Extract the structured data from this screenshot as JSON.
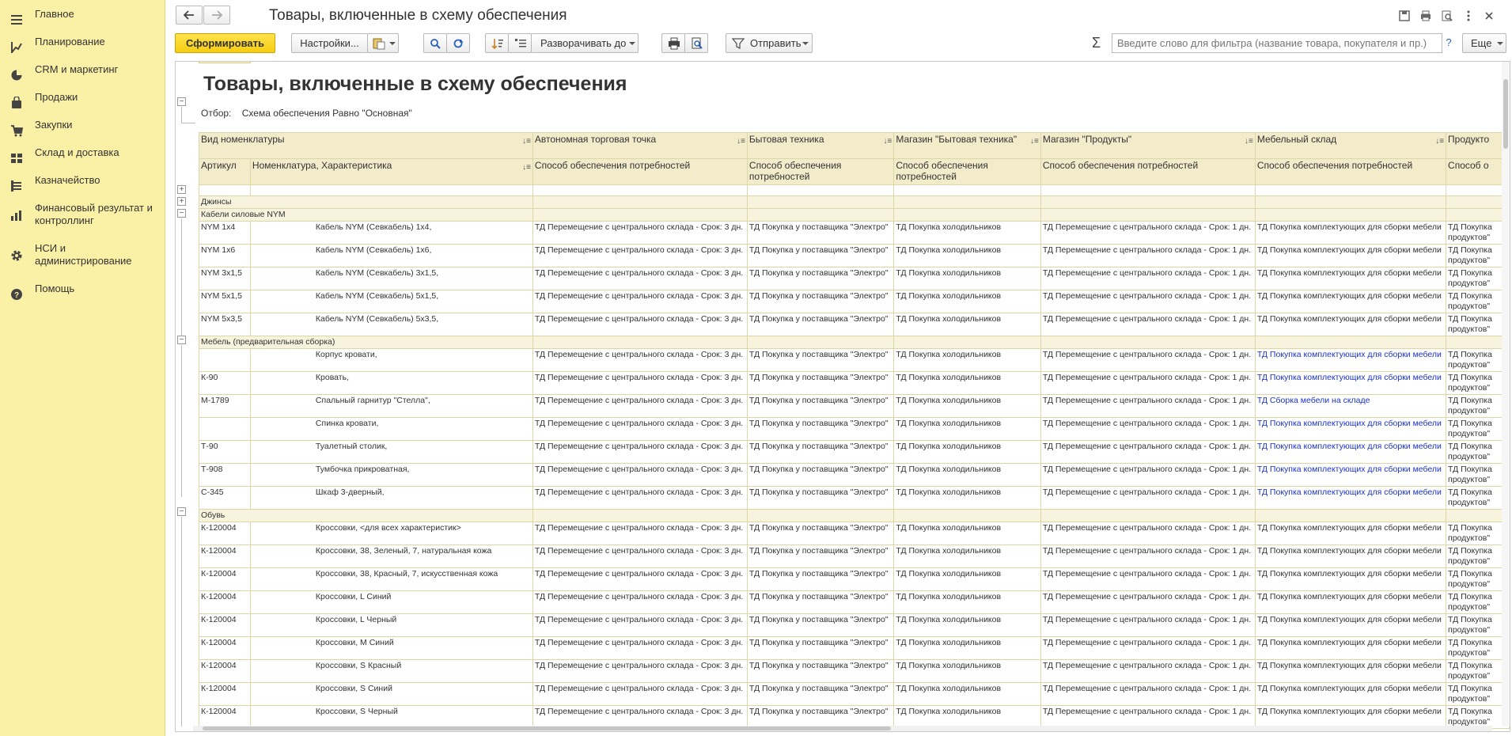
{
  "sidebar": {
    "items": [
      {
        "label": "Главное",
        "icon": "menu-icon"
      },
      {
        "label": "Планирование",
        "icon": "planning-icon"
      },
      {
        "label": "CRM и маркетинг",
        "icon": "pie-icon"
      },
      {
        "label": "Продажи",
        "icon": "bag-icon"
      },
      {
        "label": "Закупки",
        "icon": "cart-icon"
      },
      {
        "label": "Склад и доставка",
        "icon": "warehouse-icon"
      },
      {
        "label": "Казначейство",
        "icon": "treasury-icon"
      },
      {
        "label": "Финансовый результат и контроллинг",
        "icon": "bars-icon"
      },
      {
        "label": "НСИ и администрирование",
        "icon": "gear-icon"
      },
      {
        "label": "Помощь",
        "icon": "help-icon"
      }
    ]
  },
  "header": {
    "title": "Товары, включенные в схему обеспечения"
  },
  "toolbar": {
    "generate": "Сформировать",
    "settings": "Настройки...",
    "expand": "Разворачивать до",
    "send": "Отправить",
    "more": "Еще",
    "sigma": "Σ",
    "help": "?",
    "filter_placeholder": "Введите слово для фильтра (название товара, покупателя и пр.)"
  },
  "report": {
    "title": "Товары, включенные в схему обеспечения",
    "filter_label": "Отбор:",
    "filter_value": "Схема обеспечения Равно \"Основная\"",
    "headers1": [
      "Вид номенклатуры",
      "Автономная торговая точка",
      "Бытовая техника",
      "Магазин \"Бытовая техника\"",
      "Магазин \"Продукты\"",
      "Мебельный склад",
      "Продукто"
    ],
    "headers2": [
      "Артикул",
      "Номенклатура, Характеристика",
      "Способ обеспечения потребностей",
      "Способ обеспечения потребностей",
      "Способ обеспечения потребностей",
      "Способ обеспечения потребностей",
      "Способ обеспечения потребностей",
      "Способ о"
    ],
    "groups": {
      "jeans": "Джинсы",
      "cables": "Кабели силовые NYM",
      "furniture": "Мебель (предварительная сборка)",
      "shoes": "Обувь"
    },
    "val": {
      "c1": "ТД Перемещение с центрального склада - Срок: 3 дн.",
      "c2": "ТД Покупка у поставщика \"Электро\"",
      "c3": "ТД Покупка холодильников",
      "c4": "ТД Перемещение с центрального склада - Срок: 1 дн.",
      "c5": "ТД Покупка комплектующих для сборки мебели",
      "c5b": "ТД Сборка мебели на складе",
      "c6": "ТД Покупка продуктов\""
    },
    "rows": [
      {
        "art": "NYM 1x4",
        "name": "Кабель NYM (Севкабель) 1x4,"
      },
      {
        "art": "NYM 1x6",
        "name": "Кабель NYM (Севкабель) 1x6,"
      },
      {
        "art": "NYM 3x1,5",
        "name": "Кабель NYM (Севкабель) 3x1,5,"
      },
      {
        "art": "NYM 5x1,5",
        "name": "Кабель NYM (Севкабель) 5x1,5,"
      },
      {
        "art": "NYM 5x3,5",
        "name": "Кабель NYM (Севкабель) 5x3,5,"
      },
      {
        "art": "",
        "name": "Корпус кровати,"
      },
      {
        "art": "К-90",
        "name": "Кровать,"
      },
      {
        "art": "М-1789",
        "name": "Спальный гарнитур \"Стелла\","
      },
      {
        "art": "",
        "name": "Спинка кровати,"
      },
      {
        "art": "Т-90",
        "name": "Туалетный столик,"
      },
      {
        "art": "Т-908",
        "name": "Тумбочка прикроватная,"
      },
      {
        "art": "С-345",
        "name": "Шкаф 3-дверный,"
      },
      {
        "art": "К-120004",
        "name": "Кроссовки, <для всех характеристик>"
      },
      {
        "art": "К-120004",
        "name": "Кроссовки, 38, Зеленый, 7, натуральная кожа"
      },
      {
        "art": "К-120004",
        "name": "Кроссовки, 38, Красный, 7, искусственная кожа"
      },
      {
        "art": "К-120004",
        "name": "Кроссовки, L Синий"
      },
      {
        "art": "К-120004",
        "name": "Кроссовки, L Черный"
      },
      {
        "art": "К-120004",
        "name": "Кроссовки, M Синий"
      },
      {
        "art": "К-120004",
        "name": "Кроссовки, S Красный"
      },
      {
        "art": "К-120004",
        "name": "Кроссовки, S Синий"
      },
      {
        "art": "К-120004",
        "name": "Кроссовки, S Черный"
      }
    ]
  }
}
